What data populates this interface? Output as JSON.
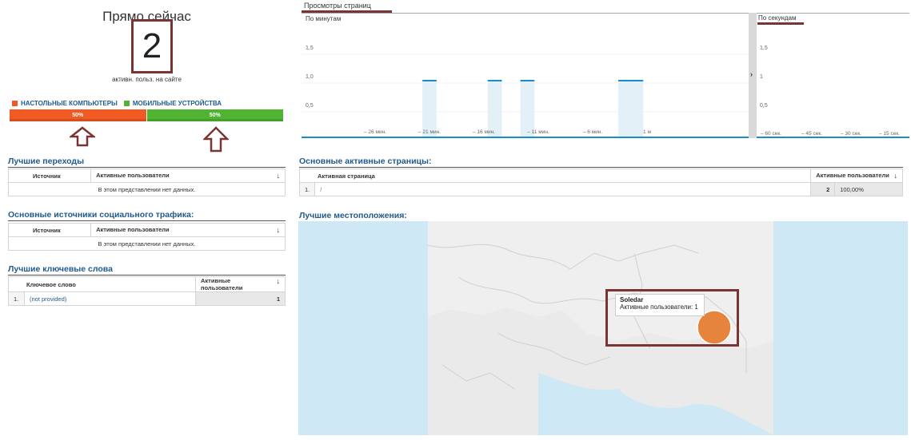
{
  "now": {
    "title": "Прямо сейчас",
    "count": "2",
    "subtitle": "активн. польз. на сайте"
  },
  "devices": {
    "legend": [
      {
        "label": "НАСТОЛЬНЫЕ КОМПЬЮТЕРЫ",
        "color": "#f15a22"
      },
      {
        "label": "МОБИЛЬНЫЕ УСТРОЙСТВА",
        "color": "#50b432"
      }
    ],
    "segments": [
      {
        "label": "50%",
        "value": 50,
        "color": "#f15a22"
      },
      {
        "label": "50%",
        "value": 50,
        "color": "#50b432"
      }
    ]
  },
  "top_referrals": {
    "title": "Лучшие переходы",
    "col_source": "Источник",
    "col_users": "Активные пользователи",
    "sort_icon": "↓",
    "empty": "В этом представлении нет данных."
  },
  "social": {
    "title": "Основные источники социального трафика:",
    "col_source": "Источник",
    "col_users": "Активные пользователи",
    "sort_icon": "↓",
    "empty": "В этом представлении нет данных."
  },
  "keywords": {
    "title": "Лучшие ключевые слова",
    "col_keyword": "Ключевое слово",
    "col_users": "Активные пользователи",
    "sort_icon": "↓",
    "rows": [
      {
        "index": "1.",
        "keyword": "(not provided)",
        "users": "1"
      }
    ]
  },
  "pageviews": {
    "tab": "Просмотры страниц",
    "per_minute": "По минутам",
    "per_second": "По секундам",
    "splitter_icon": "›"
  },
  "chart_data": [
    {
      "type": "bar",
      "title": "По минутам",
      "y_ticks": [
        "1,5",
        "1,0",
        "0,5"
      ],
      "ylim": [
        0,
        2
      ],
      "x_ticks": [
        "– 26 мин.",
        "– 21 мин.",
        "– 16 мин.",
        "– 11 мин.",
        "– 6 мин.",
        "1 м"
      ],
      "x_tick_minutes": [
        -26,
        -21,
        -16,
        -11,
        -6,
        -1
      ],
      "bars": [
        {
          "minute": -21,
          "value": 1
        },
        {
          "minute": -15,
          "value": 1
        },
        {
          "minute": -12,
          "value": 1
        },
        {
          "minute": -3,
          "value": 1
        },
        {
          "minute": -2,
          "value": 1
        }
      ],
      "bar_color": "#e3f0f8",
      "bar_top_color": "#1a8ccc",
      "baseline_color": "#1a8ccc"
    },
    {
      "type": "bar",
      "title": "По секундам",
      "y_ticks": [
        "1,5",
        "1",
        "0,5"
      ],
      "ylim": [
        0,
        2
      ],
      "x_ticks": [
        "– 60 сек.",
        "– 45 сек.",
        "– 30 сек.",
        "– 15 сек."
      ],
      "bars": []
    }
  ],
  "active_pages": {
    "title": "Основные активные страницы:",
    "col_page": "Активная страница",
    "col_users": "Активные пользователи",
    "sort_icon": "↓",
    "rows": [
      {
        "index": "1.",
        "page": "/",
        "users": "2",
        "percent": "100,00%"
      }
    ]
  },
  "locations": {
    "title": "Лучшие местоположения:",
    "tooltip_city": "Soledar",
    "tooltip_text": "Активные пользователи: 1",
    "bubble_color": "#e67e33"
  }
}
